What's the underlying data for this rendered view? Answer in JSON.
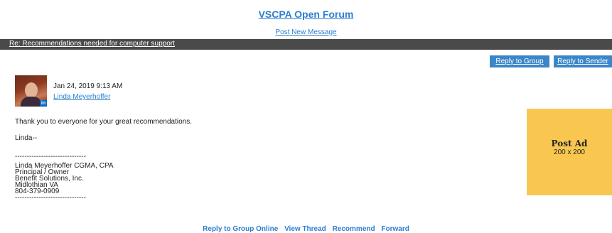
{
  "forum": {
    "title": "VSCPA Open Forum",
    "post_new": "Post New Message"
  },
  "thread": {
    "subject": "Re: Recommendations needed for computer support"
  },
  "actions": {
    "reply_group": "Reply to Group",
    "reply_sender": "Reply to Sender"
  },
  "post": {
    "date": "Jan 24, 2019 9:13 AM",
    "author": "Linda Meyerhoffer",
    "avatar_badge": "in",
    "body": [
      "Thank you to everyone for your great recommendations.",
      "Linda--"
    ],
    "signature": [
      "------------------------------",
      "Linda Meyerhoffer CGMA, CPA",
      "Principal / Owner",
      "Benefit Solutions, Inc.",
      "Midlothian VA",
      "804-379-0909",
      "------------------------------"
    ]
  },
  "ad": {
    "title": "Post Ad",
    "size": "200 x 200",
    "color": "#f9c74f"
  },
  "footer": {
    "links": [
      "Reply to Group Online",
      "View Thread",
      "Recommend",
      "Forward"
    ]
  },
  "colors": {
    "link": "#2d7fd0",
    "button": "#3b86c8",
    "thread_bar": "#4a4a4a"
  }
}
